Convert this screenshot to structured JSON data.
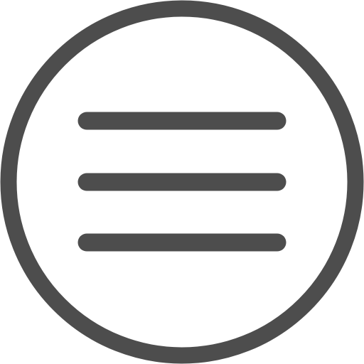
{
  "icon": {
    "name": "hamburger-menu-circle-icon",
    "stroke_color": "#4d4d4d",
    "background_color": "#ffffff"
  }
}
